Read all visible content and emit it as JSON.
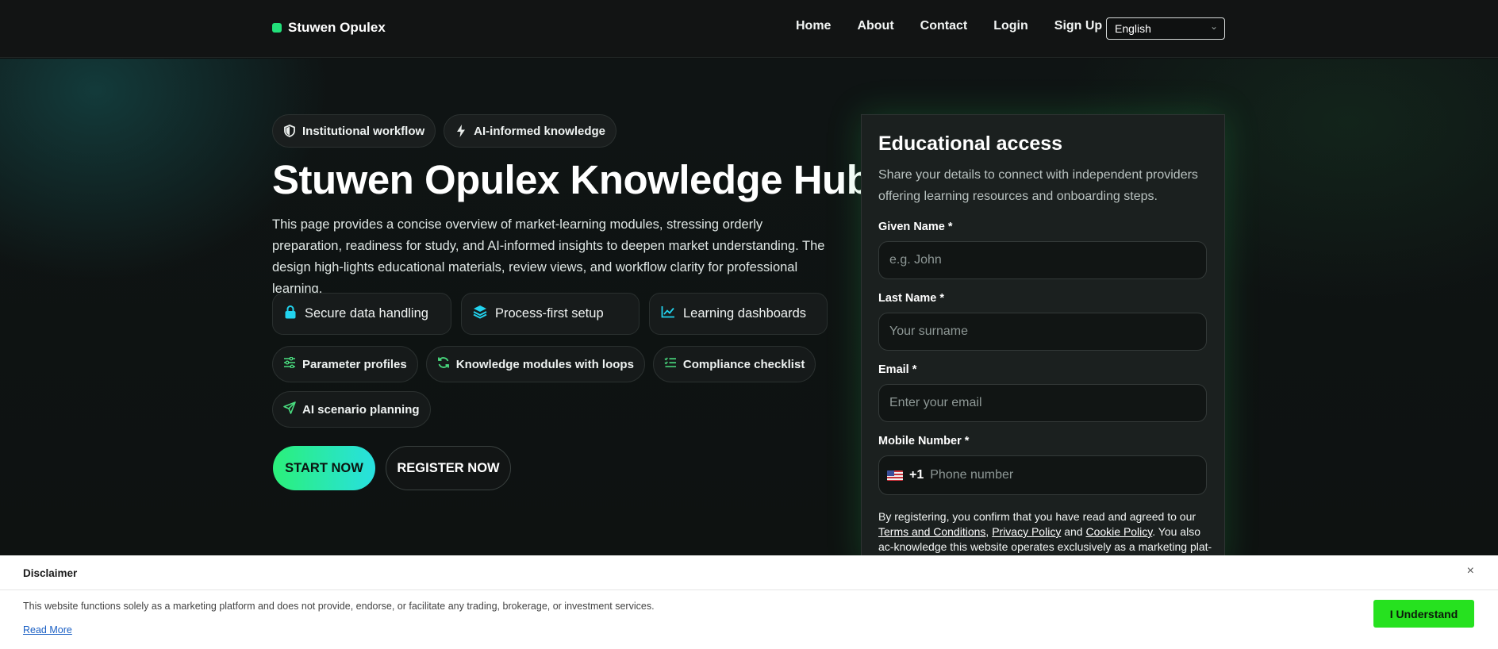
{
  "header": {
    "brand": "Stuwen Opulex",
    "nav": [
      "Home",
      "About",
      "Contact",
      "Login",
      "Sign Up"
    ],
    "language": "English"
  },
  "hero": {
    "badges": [
      "Institutional workflow",
      "AI-informed knowledge"
    ],
    "title": "Stuwen Opulex Knowledge Hub",
    "description": "This page provides a concise overview of market-learning modules, stressing orderly preparation, readiness for study, and AI-informed insights to deepen market understanding. The design high-lights educational materials, review views, and workflow clarity for professional learning.",
    "features": [
      {
        "label": "Secure data handling",
        "icon": "lock-icon"
      },
      {
        "label": "Process-first setup",
        "icon": "layers-icon"
      },
      {
        "label": "Learning dashboards",
        "icon": "chart-line-icon"
      }
    ],
    "tags": [
      {
        "label": "Parameter profiles",
        "icon": "sliders-icon"
      },
      {
        "label": "Knowledge modules with loops",
        "icon": "refresh-icon"
      },
      {
        "label": "Compliance checklist",
        "icon": "checklist-icon"
      },
      {
        "label": "AI scenario planning",
        "icon": "send-icon"
      }
    ],
    "start_label": "START NOW",
    "register_label": "REGISTER NOW"
  },
  "form": {
    "title": "Educational access",
    "subtitle": "Share your details to connect with independent providers offering learning resources and onboarding steps.",
    "given_name_label": "Given Name *",
    "given_name_placeholder": "e.g. John",
    "last_name_label": "Last Name *",
    "last_name_placeholder": "Your surname",
    "email_label": "Email *",
    "email_placeholder": "Enter your email",
    "mobile_label": "Mobile Number *",
    "dial_code": "+1",
    "phone_placeholder": "Phone number",
    "consent_prefix": "By registering, you confirm that you have read and agreed to our",
    "terms": "Terms and Conditions",
    "comma": ",",
    "privacy": "Privacy Policy",
    "and": "and",
    "cookie": "Cookie Policy",
    "consent_suffix": ". You also ac-knowledge this website operates exclusively as a marketing plat-"
  },
  "disclaimer": {
    "title": "Disclaimer",
    "close": "×",
    "text": "This website functions solely as a marketing platform and does not provide, endorse, or facilitate any trading, brokerage, or investment services.",
    "read_more": "Read More",
    "button": "I Understand"
  },
  "colors": {
    "accent_green": "#26e11f",
    "gradient_start": "#2bf07a",
    "gradient_end": "#28e0e0",
    "icon_cyan": "#22d3ee",
    "icon_green": "#4ade80"
  }
}
